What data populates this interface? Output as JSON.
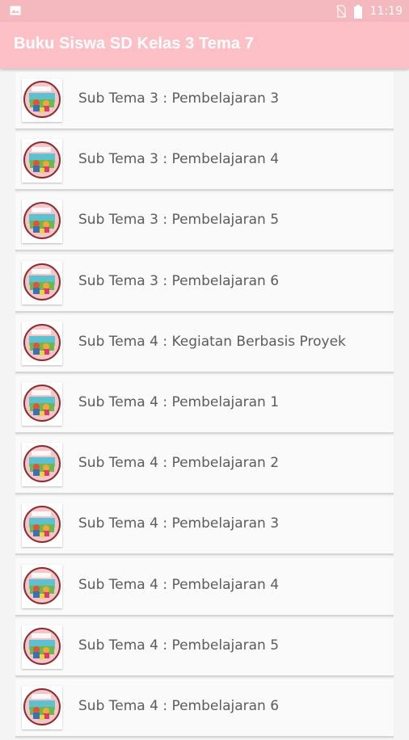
{
  "status_bar": {
    "time": "11:19",
    "icons": [
      "image-icon",
      "no-sim-icon",
      "battery-icon"
    ]
  },
  "app_bar": {
    "title": "Buku Siswa SD Kelas 3 Tema 7",
    "color": "#fdc0c6"
  },
  "list": {
    "items": [
      {
        "label": "Sub Tema 3 : Pembelajaran 3",
        "icon": "book-cover-icon"
      },
      {
        "label": "Sub Tema 3 : Pembelajaran 4",
        "icon": "book-cover-icon"
      },
      {
        "label": "Sub Tema 3 : Pembelajaran 5",
        "icon": "book-cover-icon"
      },
      {
        "label": "Sub Tema 3 : Pembelajaran 6",
        "icon": "book-cover-icon"
      },
      {
        "label": "Sub Tema 4 : Kegiatan Berbasis Proyek",
        "icon": "book-cover-icon"
      },
      {
        "label": "Sub Tema 4 : Pembelajaran 1",
        "icon": "book-cover-icon"
      },
      {
        "label": "Sub Tema 4 : Pembelajaran 2",
        "icon": "book-cover-icon"
      },
      {
        "label": "Sub Tema 4 : Pembelajaran 3",
        "icon": "book-cover-icon"
      },
      {
        "label": "Sub Tema 4 : Pembelajaran 4",
        "icon": "book-cover-icon"
      },
      {
        "label": "Sub Tema 4 : Pembelajaran 5",
        "icon": "book-cover-icon"
      },
      {
        "label": "Sub Tema 4 : Pembelajaran 6",
        "icon": "book-cover-icon"
      }
    ]
  }
}
